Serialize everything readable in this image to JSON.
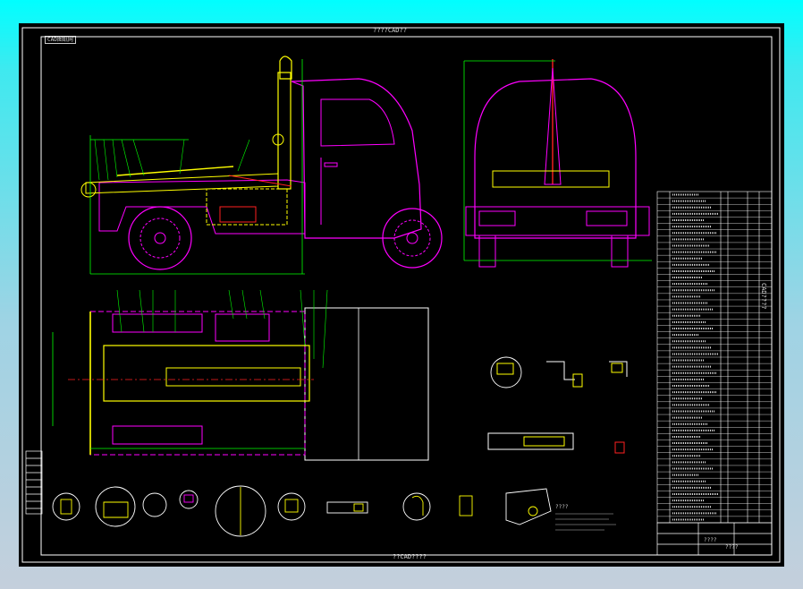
{
  "sheet": {
    "top_caption": "????CAD??",
    "bottom_caption": "??CAD????",
    "corner_tag": "CAD图纸网",
    "side_label": "CAD????",
    "title_block": {
      "title": "????",
      "drawn": "????"
    },
    "note_heading": "????"
  },
  "colors": {
    "background": "#000000",
    "frame": "#ffffff",
    "body_outline": "#ff00ff",
    "mechanism": "#ffff00",
    "accent_red": "#ff2020",
    "dimension": "#00ff00",
    "guide": "#00ffff",
    "window_gradient_top": "#00ffff",
    "window_gradient_bottom": "#c4cfdc"
  }
}
